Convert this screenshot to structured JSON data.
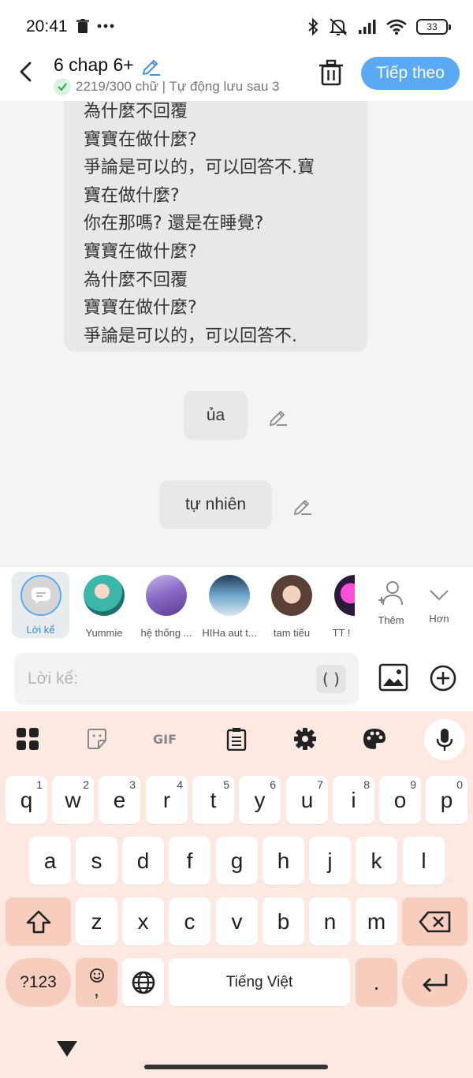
{
  "status": {
    "time": "20:41",
    "battery": "33"
  },
  "header": {
    "title": "6 chap 6+",
    "subtitle": "2219/300 chữ | Tự động lưu sau 3",
    "next_label": "Tiếp theo"
  },
  "chat": {
    "long_lines": [
      "為什麼不回覆",
      "寶寶在做什麼?",
      "爭論是可以的，可以回答不.寶",
      "寶在做什麼?",
      "你在那嗎? 還是在睡覺?",
      "寶寶在做什麼?",
      "為什麼不回覆",
      "寶寶在做什麼?",
      "爭論是可以的，可以回答不."
    ],
    "msg1": "ủa",
    "msg2": "tự nhiên"
  },
  "characters": {
    "narrator": "Lời kể",
    "items": [
      "Yummie",
      "hệ thống ...",
      "HIHa aut t...",
      "tam tiếu",
      "TT !"
    ],
    "more": "Thêm",
    "expand": "Hơn"
  },
  "input": {
    "placeholder": "Lời kể:",
    "paren": "( )"
  },
  "keyboard": {
    "row1": [
      "q",
      "w",
      "e",
      "r",
      "t",
      "y",
      "u",
      "i",
      "o",
      "p"
    ],
    "row1_nums": [
      "1",
      "2",
      "3",
      "4",
      "5",
      "6",
      "7",
      "8",
      "9",
      "0"
    ],
    "row2": [
      "a",
      "s",
      "d",
      "f",
      "g",
      "h",
      "j",
      "k",
      "l"
    ],
    "row3": [
      "z",
      "x",
      "c",
      "v",
      "b",
      "n",
      "m"
    ],
    "sym": "?123",
    "emoji_comma": ",",
    "space": "Tiếng Việt",
    "period": "."
  },
  "colors": {
    "accent": "#5aa9f3",
    "keyboard_bg": "#fde9e2",
    "fn_key": "#f7cdbd"
  }
}
